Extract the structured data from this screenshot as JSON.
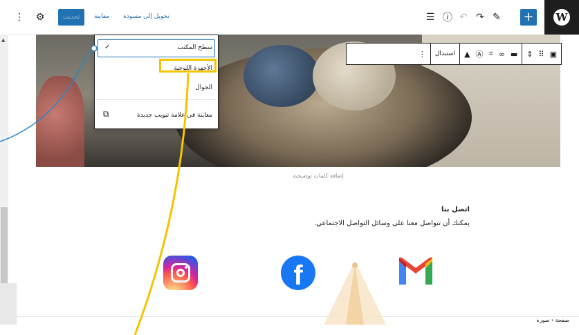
{
  "topbar": {
    "update_label": "تحديث",
    "preview_label": "معاينة",
    "draft_label": "تحويل إلى مسودة",
    "logo_letter": "W"
  },
  "block_toolbar": {
    "replace_label": "استبدال"
  },
  "preview_menu": {
    "items": [
      "سطح المكتب",
      "الأجهزة اللوحية",
      "الجوال"
    ],
    "new_tab_label": "معاينة في علامة تبويب جديدة",
    "selected": "سطح المكتب"
  },
  "content": {
    "caption_placeholder": "إضافة كلمات توضيحية",
    "contact_title": "اتصل بنا",
    "contact_text": "يمكنك أن تتواصل معنا على وسائل التواصل الاجتماعي.",
    "social_icons": [
      "instagram-icon",
      "facebook-icon",
      "gmail-icon"
    ]
  },
  "statusbar": {
    "breadcrumb": [
      "صفحة",
      "صورة"
    ],
    "separator": "‹"
  },
  "colors": {
    "accent": "#2271b1",
    "highlight": "#f5c400",
    "annotation": "#2a86c9"
  }
}
